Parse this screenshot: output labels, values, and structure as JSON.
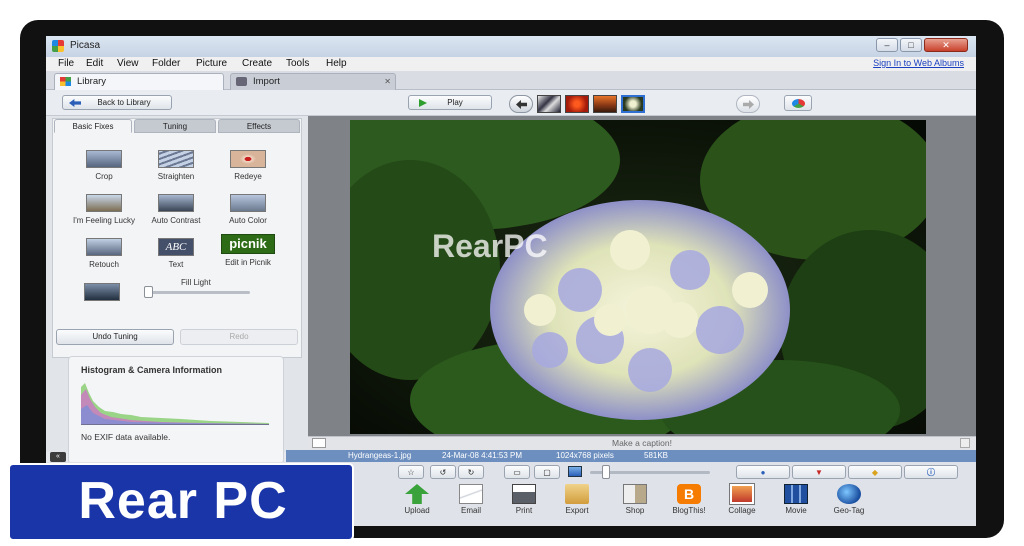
{
  "window": {
    "title": "Picasa",
    "min": "–",
    "max": "□",
    "close": "✕"
  },
  "menu": [
    "File",
    "Edit",
    "View",
    "Folder",
    "Picture",
    "Create",
    "Tools",
    "Help"
  ],
  "signin": "Sign In to Web Albums",
  "tabs": [
    {
      "label": "Library"
    },
    {
      "label": "Import",
      "close": "✕"
    }
  ],
  "toolbar": {
    "back": "Back to Library",
    "play": "Play"
  },
  "panel_tabs": [
    "Basic Fixes",
    "Tuning",
    "Effects"
  ],
  "fixes": [
    "Crop",
    "Straighten",
    "Redeye",
    "I'm Feeling Lucky",
    "Auto Contrast",
    "Auto Color",
    "Retouch",
    "Text",
    "Edit in Picnik"
  ],
  "picnik_logo": "picnik",
  "fill_light": "Fill Light",
  "undo": "Undo Tuning",
  "redo": "Redo",
  "histogram": {
    "title": "Histogram & Camera Information",
    "exif": "No EXIF data available."
  },
  "caption": "Make a caption!",
  "info": {
    "file": "Hydrangeas-1.jpg",
    "date": "24-Mar-08 4:41:53 PM",
    "size": "1024x768 pixels",
    "bytes": "581KB"
  },
  "watermark": "RearPC",
  "bottom_actions": [
    "Upload",
    "Email",
    "Print",
    "Export",
    "Shop",
    "BlogThis!",
    "Collage",
    "Movie",
    "Geo-Tag"
  ],
  "brand": "Rear PC"
}
